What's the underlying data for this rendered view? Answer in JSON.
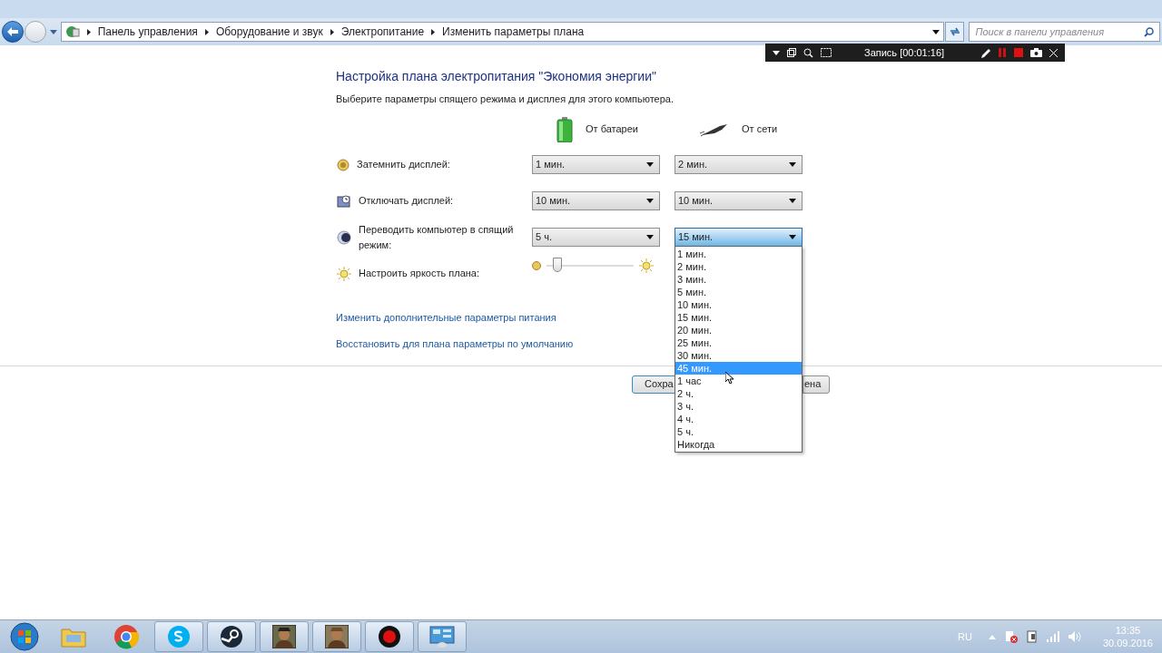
{
  "address_bar": {
    "crumbs": [
      "Панель управления",
      "Оборудование и звук",
      "Электропитание",
      "Изменить параметры плана"
    ],
    "search_placeholder": "Поиск в панели управления"
  },
  "recorder": {
    "status": "Запись [00:01:16]"
  },
  "heading": "Настройка плана электропитания \"Экономия энергии\"",
  "subheading": "Выберите параметры спящего режима и дисплея для этого компьютера.",
  "columns": [
    {
      "label": "От батареи",
      "kind": "battery"
    },
    {
      "label": "От сети",
      "kind": "plug"
    }
  ],
  "settings": [
    {
      "label": "Затемнить дисплей:",
      "kind": "dropdown",
      "values": [
        {
          "value": "1 мин.",
          "open": false
        },
        {
          "value": "2 мин.",
          "open": false
        }
      ]
    },
    {
      "label": "Отключать дисплей:",
      "kind": "dropdown",
      "values": [
        {
          "value": "10 мин.",
          "open": false
        },
        {
          "value": "10 мин.",
          "open": false
        }
      ]
    },
    {
      "label": "Переводить компьютер в спящий режим:",
      "kind": "dropdown",
      "values": [
        {
          "value": "5 ч.",
          "open": false
        },
        {
          "value": "15 мин.",
          "open": true
        }
      ]
    },
    {
      "label": "Настроить яркость плана:",
      "kind": "slider",
      "level": 0.12
    }
  ],
  "open_list": [
    {
      "label": "1 мин.",
      "selected": false
    },
    {
      "label": "2 мин.",
      "selected": false
    },
    {
      "label": "3 мин.",
      "selected": false
    },
    {
      "label": "5 мин.",
      "selected": false
    },
    {
      "label": "10 мин.",
      "selected": false
    },
    {
      "label": "15 мин.",
      "selected": false
    },
    {
      "label": "20 мин.",
      "selected": false
    },
    {
      "label": "25 мин.",
      "selected": false
    },
    {
      "label": "30 мин.",
      "selected": false
    },
    {
      "label": "45 мин.",
      "selected": true
    },
    {
      "label": "1 час",
      "selected": false
    },
    {
      "label": "2 ч.",
      "selected": false
    },
    {
      "label": "3 ч.",
      "selected": false
    },
    {
      "label": "4 ч.",
      "selected": false
    },
    {
      "label": "5 ч.",
      "selected": false
    },
    {
      "label": "Никогда",
      "selected": false
    }
  ],
  "links": [
    "Изменить дополнительные параметры питания",
    "Восстановить для плана параметры по умолчанию"
  ],
  "buttons": [
    "Сохра",
    "ена"
  ],
  "tray": {
    "language": "RU",
    "time": "13:35",
    "date": "30.09.2016"
  }
}
